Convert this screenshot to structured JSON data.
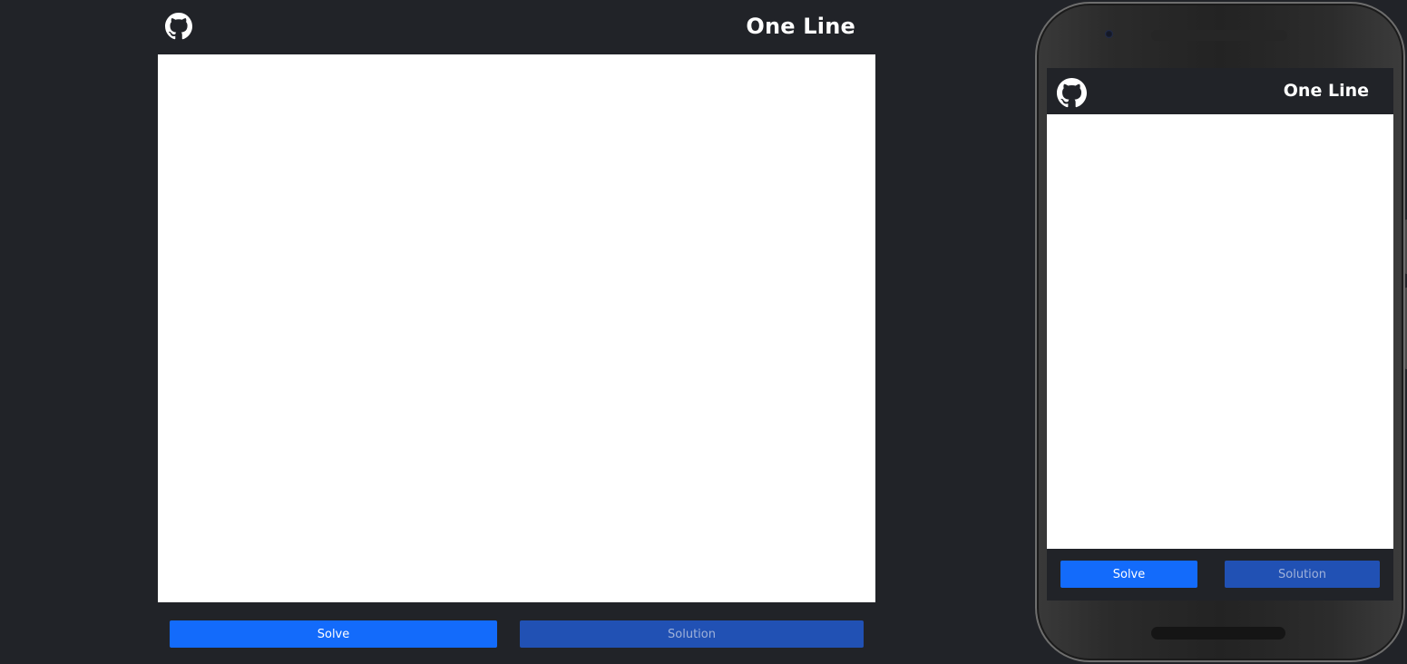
{
  "app": {
    "title": "One Line",
    "github_icon": "github-icon"
  },
  "desktop": {
    "title": "One Line",
    "buttons": {
      "solve": "Solve",
      "solution": "Solution"
    }
  },
  "mobile": {
    "title": "One Line",
    "buttons": {
      "solve": "Solve",
      "solution": "Solution"
    }
  },
  "colors": {
    "background": "#212328",
    "canvas": "#ffffff",
    "solve_button": "#136bfb",
    "solution_button": "#2151b4",
    "solution_text": "#9fb2da"
  }
}
